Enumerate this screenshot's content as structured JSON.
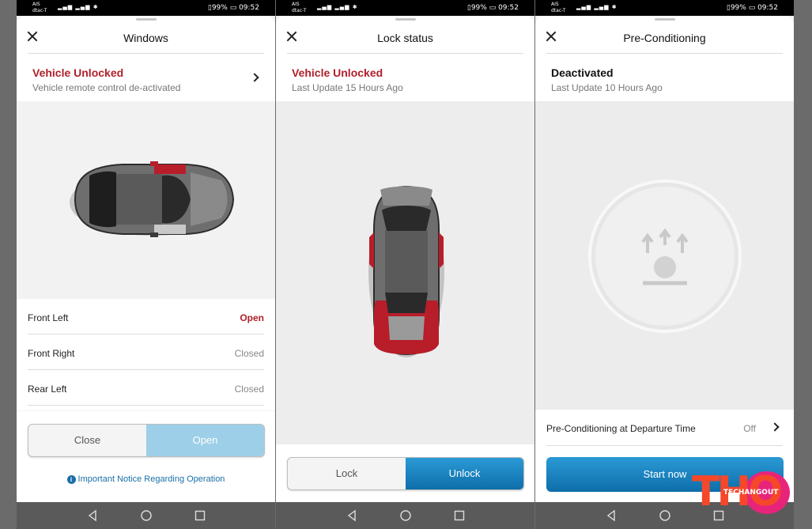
{
  "status_bar": {
    "carrier1": "AIS",
    "carrier2": "dtac-T",
    "battery": "99%",
    "time": "09:52"
  },
  "windows_screen": {
    "title": "Windows",
    "status_title": "Vehicle Unlocked",
    "status_sub": "Vehicle remote control de-activated",
    "rows": [
      {
        "label": "Front Left",
        "value": "Open"
      },
      {
        "label": "Front Right",
        "value": "Closed"
      },
      {
        "label": "Rear Left",
        "value": "Closed"
      }
    ],
    "seg_left": "Close",
    "seg_right": "Open",
    "notice": "Important Notice Regarding Operation"
  },
  "lock_screen": {
    "title": "Lock status",
    "status_title": "Vehicle Unlocked",
    "status_sub": "Last Update 15 Hours Ago",
    "seg_left": "Lock",
    "seg_right": "Unlock"
  },
  "precond_screen": {
    "title": "Pre-Conditioning",
    "status_title": "Deactivated",
    "status_sub": "Last Update 10 Hours Ago",
    "row_label": "Pre-Conditioning at Departure Time",
    "row_value": "Off",
    "start_label": "Start now"
  },
  "watermark": {
    "brand": "THO",
    "text": "TECHANGOUT"
  },
  "colors": {
    "accent_red": "#b0202a",
    "accent_blue": "#1b8ac9",
    "light_blue": "#9dcfe8"
  },
  "icons": [
    "close-icon",
    "chevron-right-icon",
    "info-icon",
    "fan-heat-icon",
    "back-icon",
    "home-icon",
    "recents-icon"
  ]
}
